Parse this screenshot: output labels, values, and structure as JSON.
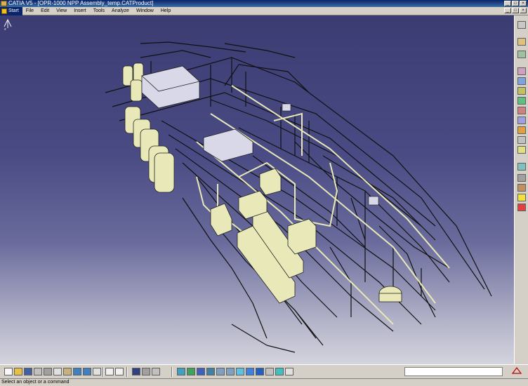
{
  "window": {
    "title": "CATIA V5 - [OPR-1000 NPP Assembly_temp.CATProduct]",
    "minimize_glyph": "_",
    "maximize_glyph": "□",
    "close_glyph": "×"
  },
  "menu": {
    "items": [
      "Start",
      "File",
      "Edit",
      "View",
      "Insert",
      "Tools",
      "Analyze",
      "Window",
      "Help"
    ]
  },
  "viewport": {
    "background_top": "#3b3c72",
    "background_bottom": "#d4d4de",
    "model_color": "#e8e8b8",
    "equipment_color": "#d8d8e8",
    "pipe_color": "#101010"
  },
  "right_toolbar": {
    "icons": [
      "sketch-icon",
      "part-icon",
      "view-tool-icon",
      "constraint-icon",
      "assembly-icon",
      "move-icon",
      "snap-icon",
      "explode-icon",
      "clash-icon",
      "section-icon",
      "measure-icon",
      "annotation-icon",
      "fit-icon",
      "material-icon",
      "lamp-icon",
      "delete-icon",
      "scene-icon",
      "catalog-icon",
      "render-icon",
      "sensor-icon",
      "analysis-icon"
    ]
  },
  "bottom_toolbar": {
    "icons": [
      "new-icon",
      "open-icon",
      "save-icon",
      "print-icon",
      "cut-icon",
      "copy-icon",
      "paste-icon",
      "undo-icon",
      "redo-icon",
      "whats-this-icon",
      "formula-icon",
      "comment-icon",
      "macro-icon",
      "graph-icon",
      "tree-icon",
      "fly-icon",
      "fit-all-icon",
      "pan-icon",
      "rotate-icon",
      "zoom-in-icon",
      "zoom-out-icon",
      "normal-view-icon",
      "iso-view-icon",
      "shading-icon",
      "hide-show-icon",
      "swap-icon",
      "layer-icon"
    ]
  },
  "status": {
    "message": "Select an object or a command"
  }
}
